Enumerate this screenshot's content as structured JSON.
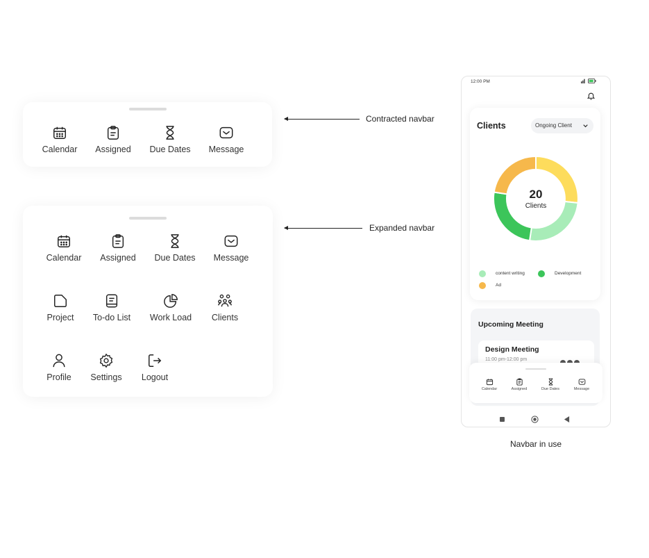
{
  "contracted": {
    "items": [
      {
        "label": "Calendar",
        "icon": "calendar-icon"
      },
      {
        "label": "Assigned",
        "icon": "clipboard-icon"
      },
      {
        "label": "Due Dates",
        "icon": "hourglass-icon"
      },
      {
        "label": "Message",
        "icon": "mail-icon"
      }
    ]
  },
  "expanded": {
    "items": [
      {
        "label": "Calendar",
        "icon": "calendar-icon"
      },
      {
        "label": "Assigned",
        "icon": "clipboard-icon"
      },
      {
        "label": "Due Dates",
        "icon": "hourglass-icon"
      },
      {
        "label": "Message",
        "icon": "mail-icon"
      },
      {
        "label": "Project",
        "icon": "folder-icon"
      },
      {
        "label": "To-do List",
        "icon": "notebook-icon"
      },
      {
        "label": "Work Load",
        "icon": "pie-chart-icon"
      },
      {
        "label": "Clients",
        "icon": "people-icon"
      },
      {
        "label": "Profile",
        "icon": "user-icon"
      },
      {
        "label": "Settings",
        "icon": "gear-icon"
      },
      {
        "label": "Logout",
        "icon": "logout-icon"
      }
    ]
  },
  "annotations": {
    "contracted": "Contracted navbar",
    "expanded": "Expanded navbar",
    "in_use": "Navbar in use"
  },
  "phone": {
    "status_time": "12:00 PM",
    "clients": {
      "title": "Clients",
      "filter": "Ongoing Client",
      "total": "20",
      "total_label": "Clients",
      "legend": [
        {
          "label": "content writing",
          "color": "#a8ecb8"
        },
        {
          "label": "Development",
          "color": "#3cc55a"
        },
        {
          "label": "Ad",
          "color": "#f6b84b"
        }
      ]
    },
    "meeting": {
      "title": "Upcoming Meeting",
      "item_title": "Design Meeting",
      "item_time": "11:00 pm-12:00 pm"
    },
    "mini_nav": {
      "items": [
        {
          "label": "Calendar",
          "icon": "calendar-icon"
        },
        {
          "label": "Assigned",
          "icon": "clipboard-icon"
        },
        {
          "label": "Due Dates",
          "icon": "hourglass-icon"
        },
        {
          "label": "Message",
          "icon": "mail-icon"
        }
      ]
    }
  },
  "colors": {
    "yellow": "#fddc5c",
    "light_green": "#a8ecb8",
    "green": "#3cc55a",
    "orange": "#f6b84b"
  }
}
